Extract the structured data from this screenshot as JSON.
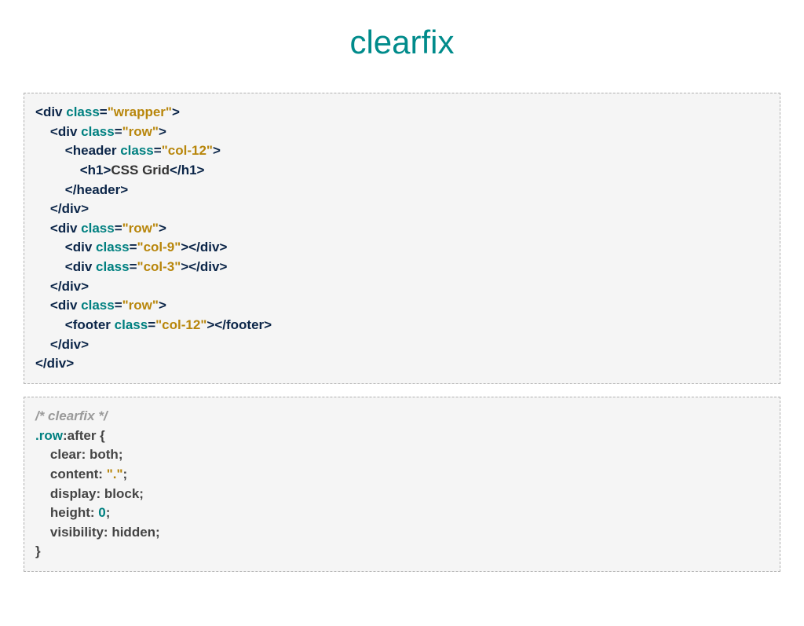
{
  "title": "clearfix",
  "html_code": {
    "lines": [
      {
        "indent": 0,
        "type": "open",
        "tag": "div",
        "attr": "class",
        "value": "wrapper"
      },
      {
        "indent": 1,
        "type": "open",
        "tag": "div",
        "attr": "class",
        "value": "row"
      },
      {
        "indent": 2,
        "type": "open",
        "tag": "header",
        "attr": "class",
        "value": "col-12"
      },
      {
        "indent": 3,
        "type": "content",
        "tag": "h1",
        "text": "CSS Grid"
      },
      {
        "indent": 2,
        "type": "close",
        "tag": "header"
      },
      {
        "indent": 1,
        "type": "close",
        "tag": "div"
      },
      {
        "indent": 1,
        "type": "open",
        "tag": "div",
        "attr": "class",
        "value": "row"
      },
      {
        "indent": 2,
        "type": "selfclose",
        "tag": "div",
        "attr": "class",
        "value": "col-9"
      },
      {
        "indent": 2,
        "type": "selfclose",
        "tag": "div",
        "attr": "class",
        "value": "col-3"
      },
      {
        "indent": 1,
        "type": "close",
        "tag": "div"
      },
      {
        "indent": 1,
        "type": "open",
        "tag": "div",
        "attr": "class",
        "value": "row"
      },
      {
        "indent": 2,
        "type": "selfclose",
        "tag": "footer",
        "attr": "class",
        "value": "col-12"
      },
      {
        "indent": 1,
        "type": "close",
        "tag": "div"
      },
      {
        "indent": 0,
        "type": "close",
        "tag": "div"
      }
    ]
  },
  "css_code": {
    "comment": "/* clearfix */",
    "selector_class": ".row",
    "selector_pseudo": ":after {",
    "declarations": [
      {
        "prop": "clear",
        "val": "both",
        "val_type": "plain"
      },
      {
        "prop": "content",
        "val": "\".\"",
        "val_type": "str"
      },
      {
        "prop": "display",
        "val": "block",
        "val_type": "plain"
      },
      {
        "prop": "height",
        "val": "0",
        "val_type": "num"
      },
      {
        "prop": "visibility",
        "val": "hidden",
        "val_type": "plain"
      }
    ],
    "close": "}"
  }
}
